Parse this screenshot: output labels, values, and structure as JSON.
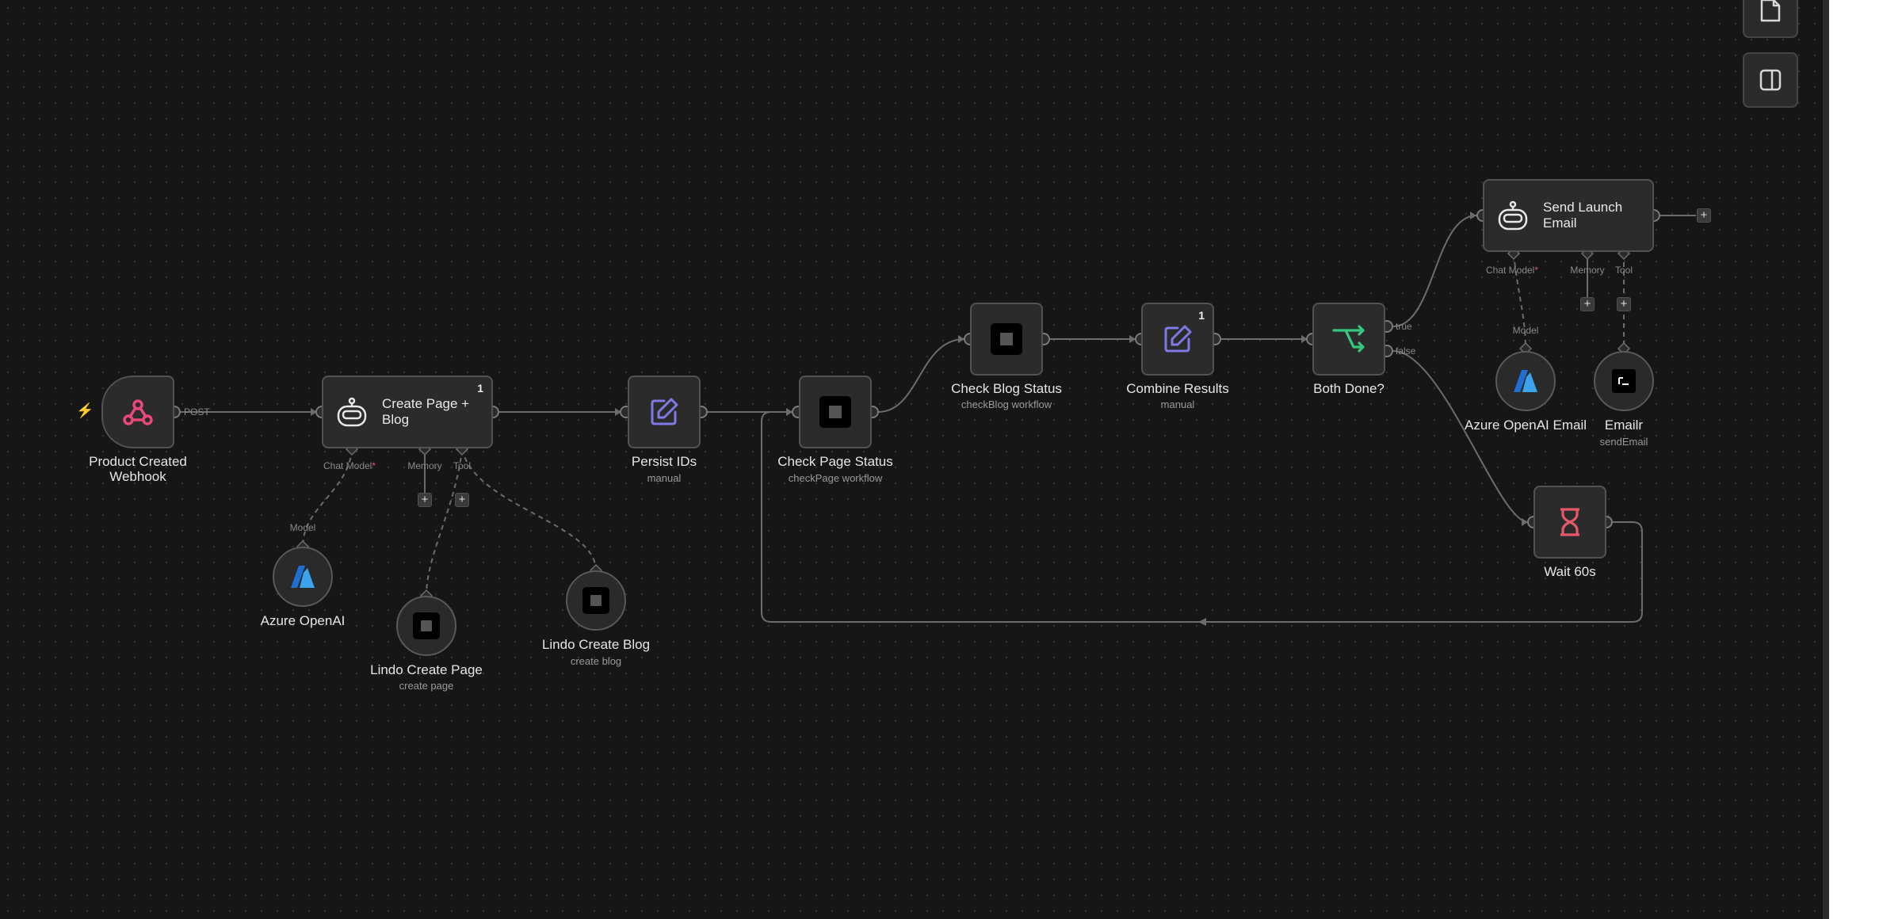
{
  "colors": {
    "canvas": "#161617",
    "node_fill": "#2b2b2c",
    "node_border": "#525252",
    "edge": "#6c6c6c",
    "webhook_icon": "#e9487a",
    "edit_icon": "#8079e6",
    "if_icon": "#35c77e",
    "wait_icon": "#e4586a",
    "azure_icon": "#2f8ee6",
    "required_mark": "#e4586a"
  },
  "toolbar": {
    "sticky_note_icon": "sticky-note-icon",
    "panel_toggle_icon": "panel-toggle-icon"
  },
  "nodes": {
    "webhook": {
      "label_line1": "Product Created",
      "label_line2": "Webhook",
      "icon": "webhook-icon",
      "edge_label": "POST"
    },
    "create_page_blog": {
      "title_line1": "Create Page +",
      "title_line2": "Blog",
      "badge": "1",
      "icon": "ai-agent-icon",
      "ports": {
        "chat_model": "Chat Model",
        "required": "*",
        "memory": "Memory",
        "tool": "Tool"
      }
    },
    "azure_openai": {
      "label": "Azure OpenAI",
      "port": "Model",
      "icon": "azure-icon"
    },
    "lindo_create_page": {
      "label": "Lindo Create Page",
      "sublabel": "create page",
      "icon": "lindo-icon"
    },
    "lindo_create_blog": {
      "label": "Lindo Create Blog",
      "sublabel": "create blog",
      "icon": "lindo-icon"
    },
    "persist_ids": {
      "label": "Persist IDs",
      "sublabel": "manual",
      "icon": "edit-icon"
    },
    "check_page_status": {
      "label": "Check Page Status",
      "sublabel": "checkPage workflow",
      "icon": "lindo-icon"
    },
    "check_blog_status": {
      "label": "Check Blog Status",
      "sublabel": "checkBlog workflow",
      "icon": "lindo-icon"
    },
    "combine_results": {
      "label": "Combine Results",
      "sublabel": "manual",
      "badge": "1",
      "icon": "edit-icon"
    },
    "both_done": {
      "label": "Both Done?",
      "icon": "if-icon",
      "true_label": "true",
      "false_label": "false"
    },
    "send_launch_email": {
      "title_line1": "Send Launch",
      "title_line2": "Email",
      "icon": "ai-agent-icon",
      "ports": {
        "chat_model": "Chat Model",
        "required": "*",
        "memory": "Memory",
        "tool": "Tool"
      }
    },
    "azure_openai_email": {
      "label": "Azure OpenAI Email",
      "port": "Model",
      "icon": "azure-icon"
    },
    "emailr": {
      "label": "Emailr",
      "sublabel": "sendEmail",
      "icon": "terminal-icon"
    },
    "wait_60s": {
      "label": "Wait 60s",
      "icon": "hourglass-icon"
    }
  },
  "add_button": "+",
  "trigger_icon": "lightning-bolt-icon"
}
